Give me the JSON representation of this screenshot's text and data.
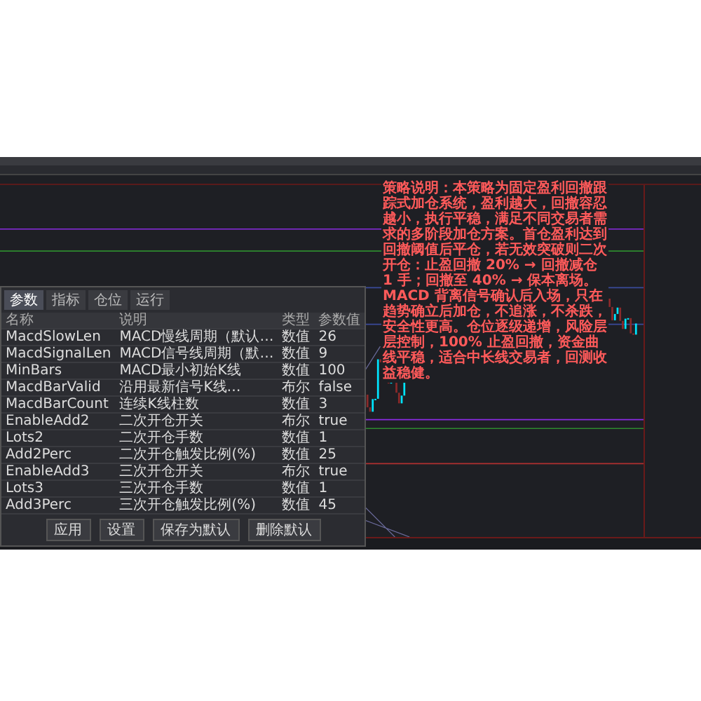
{
  "annotation": {
    "text": "策略说明：本策略为固定盈利回撤跟踪式加仓系统，盈利越大，回撤容忍越小，执行平稳，满足不同交易者需求的多阶段加仓方案。首仓盈利达到回撤阈值后平仓，若无效突破则二次开仓：止盈回撤 20% → 回撤减仓 1 手；回撤至 40% → 保本离场。MACD 背离信号确认后入场，只在趋势确立后加仓，不追涨，不杀跌，安全性更高。仓位逐级递增，风险层层控制，100% 止盈回撤，资金曲线平稳，适合中长线交易者，回测收益稳健。"
  },
  "params_dialog": {
    "tabs": [
      {
        "label": "参数",
        "selected": true
      },
      {
        "label": "指标",
        "selected": false
      },
      {
        "label": "仓位",
        "selected": false
      },
      {
        "label": "运行",
        "selected": false
      }
    ],
    "columns": [
      "名称",
      "说明",
      "类型",
      "参数值"
    ],
    "rows": [
      {
        "name": "MacdSlowLen",
        "description": "MACD慢线周期（默认…",
        "type": "数值",
        "value": "26"
      },
      {
        "name": "MacdSignalLen",
        "description": "MACD信号线周期（默…",
        "type": "数值",
        "value": "9"
      },
      {
        "name": "MinBars",
        "description": "MACD最小初始K线",
        "type": "数值",
        "value": "100"
      },
      {
        "name": "MacdBarValid",
        "description": "沿用最新信号K线…",
        "type": "布尔",
        "value": "false"
      },
      {
        "name": "MacdBarCount",
        "description": "连续K线柱数",
        "type": "数值",
        "value": "3"
      },
      {
        "name": "EnableAdd2",
        "description": "二次开仓开关",
        "type": "布尔",
        "value": "true"
      },
      {
        "name": "Lots2",
        "description": "二次开仓手数",
        "type": "数值",
        "value": "1"
      },
      {
        "name": "Add2Perc",
        "description": "二次开仓触发比例(%)",
        "type": "数值",
        "value": "25"
      },
      {
        "name": "EnableAdd3",
        "description": "三次开仓开关",
        "type": "布尔",
        "value": "true"
      },
      {
        "name": "Lots3",
        "description": "三次开仓手数",
        "type": "数值",
        "value": "1"
      },
      {
        "name": "Add3Perc",
        "description": "三次开仓触发比例(%)",
        "type": "数值",
        "value": "45"
      }
    ],
    "buttons": [
      "应用",
      "设置",
      "保存为默认",
      "删除默认"
    ]
  }
}
